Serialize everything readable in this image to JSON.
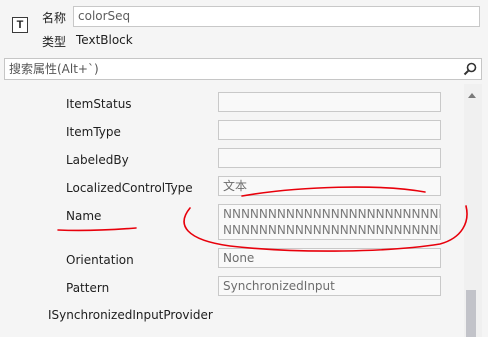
{
  "header": {
    "icon_glyph": "T",
    "name_label": "名称",
    "name_value": "colorSeq",
    "type_label": "类型",
    "type_value": "TextBlock"
  },
  "search": {
    "placeholder": "搜索属性(Alt+`)"
  },
  "properties": [
    {
      "name": "ItemStatus",
      "value": ""
    },
    {
      "name": "ItemType",
      "value": ""
    },
    {
      "name": "LabeledBy",
      "value": ""
    },
    {
      "name": "LocalizedControlType",
      "value": "文本"
    },
    {
      "name": "Name",
      "value_lines": [
        "NNNNNNNNNNNNNNNNNNNNNNNNN",
        "NNNNNNNNNNNNNNNNNNNNNNNNN"
      ]
    },
    {
      "name": "Orientation",
      "value": "None"
    },
    {
      "name": "Pattern",
      "value": "SynchronizedInput"
    }
  ],
  "group_header": "ISynchronizedInputProvider",
  "annotation": {
    "color": "#e8000b"
  },
  "icons": {
    "search": "search-icon",
    "scroll_up": "scroll-up-icon"
  }
}
